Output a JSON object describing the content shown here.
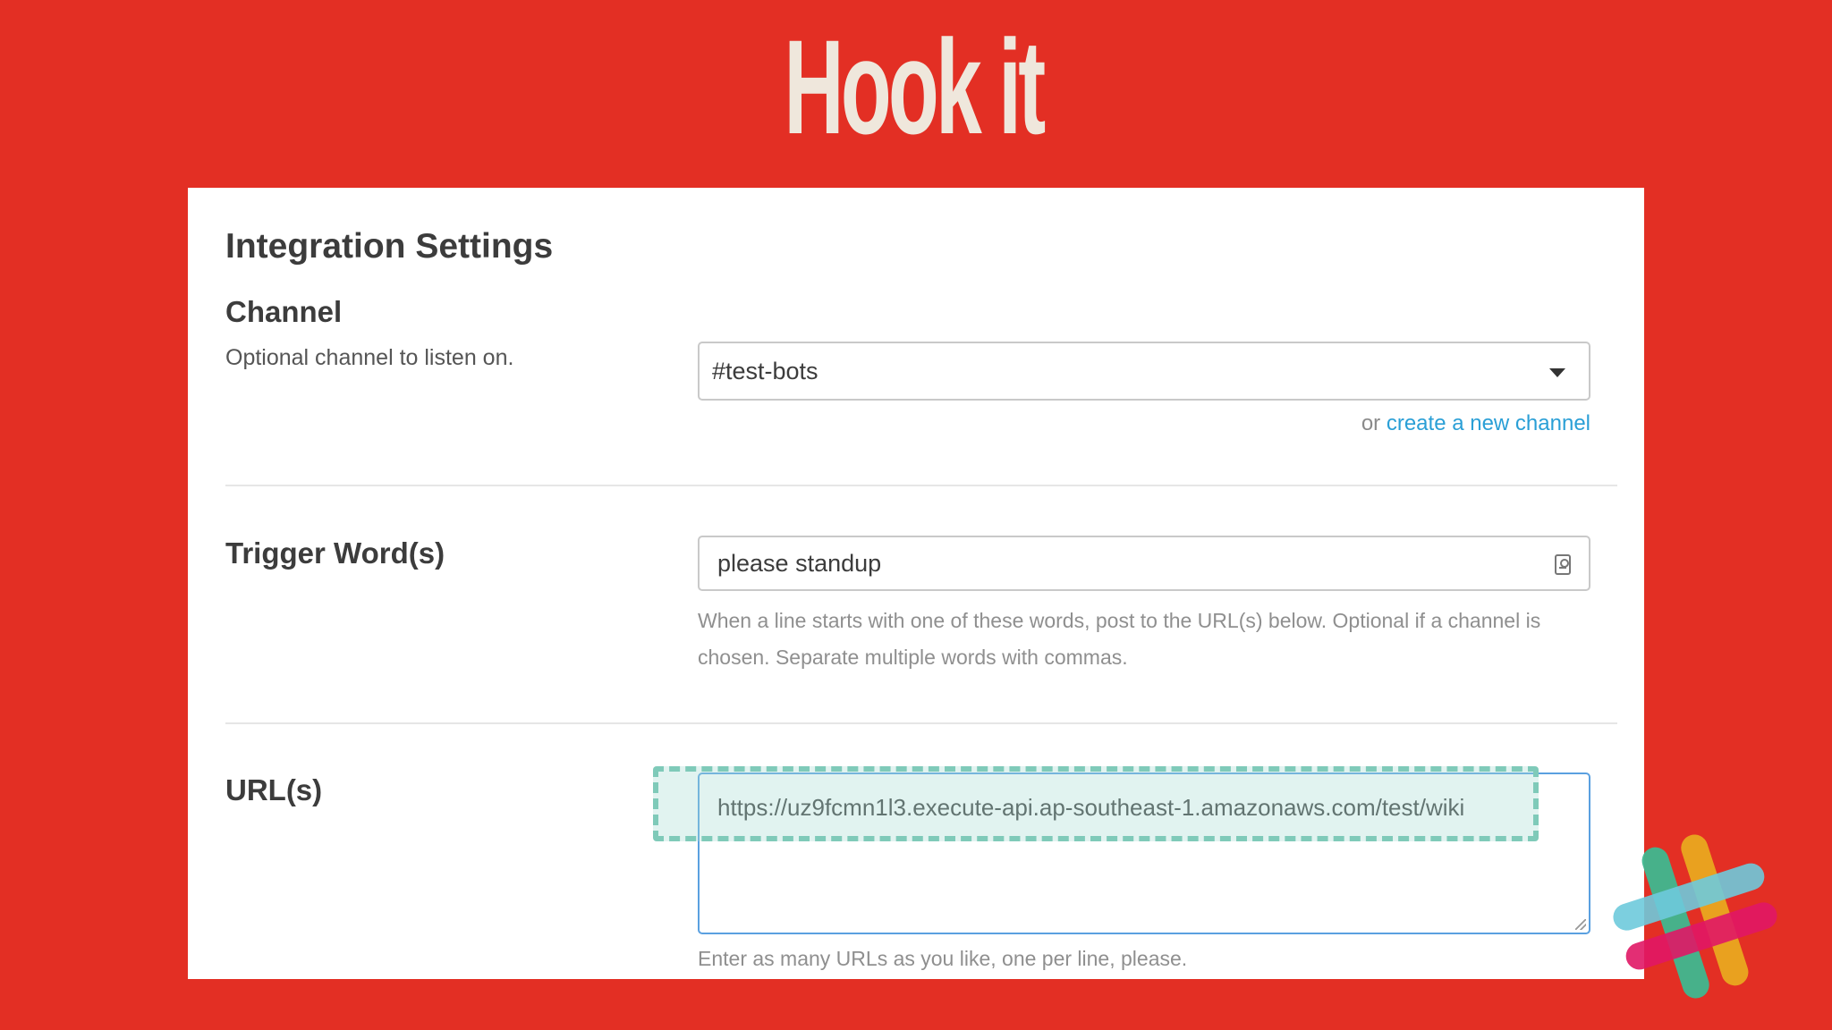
{
  "slide": {
    "title": "Hook it"
  },
  "panel": {
    "heading": "Integration Settings"
  },
  "channel": {
    "label": "Channel",
    "description": "Optional channel to listen on.",
    "selected_value": "#test-bots",
    "alt_prefix": "or ",
    "create_link": "create a new channel"
  },
  "trigger": {
    "label": "Trigger Word(s)",
    "value": "please standup",
    "help_line_1": "When a line starts with one of these words, post to the URL(s) below. Optional if a channel is",
    "help_line_2": "chosen. Separate multiple words with commas."
  },
  "urls": {
    "label": "URL(s)",
    "value": "https://uz9fcmn1l3.execute-api.ap-southeast-1.amazonaws.com/test/wiki",
    "help": "Enter as many URLs as you like, one per line, please."
  },
  "colors": {
    "background": "#e32f24",
    "link": "#2a9fd6",
    "highlight": "#7fcab9"
  },
  "icons": {
    "dropdown": "chevron-down-icon",
    "trigger_input": "contact-card-icon",
    "logo": "slack-logo"
  }
}
